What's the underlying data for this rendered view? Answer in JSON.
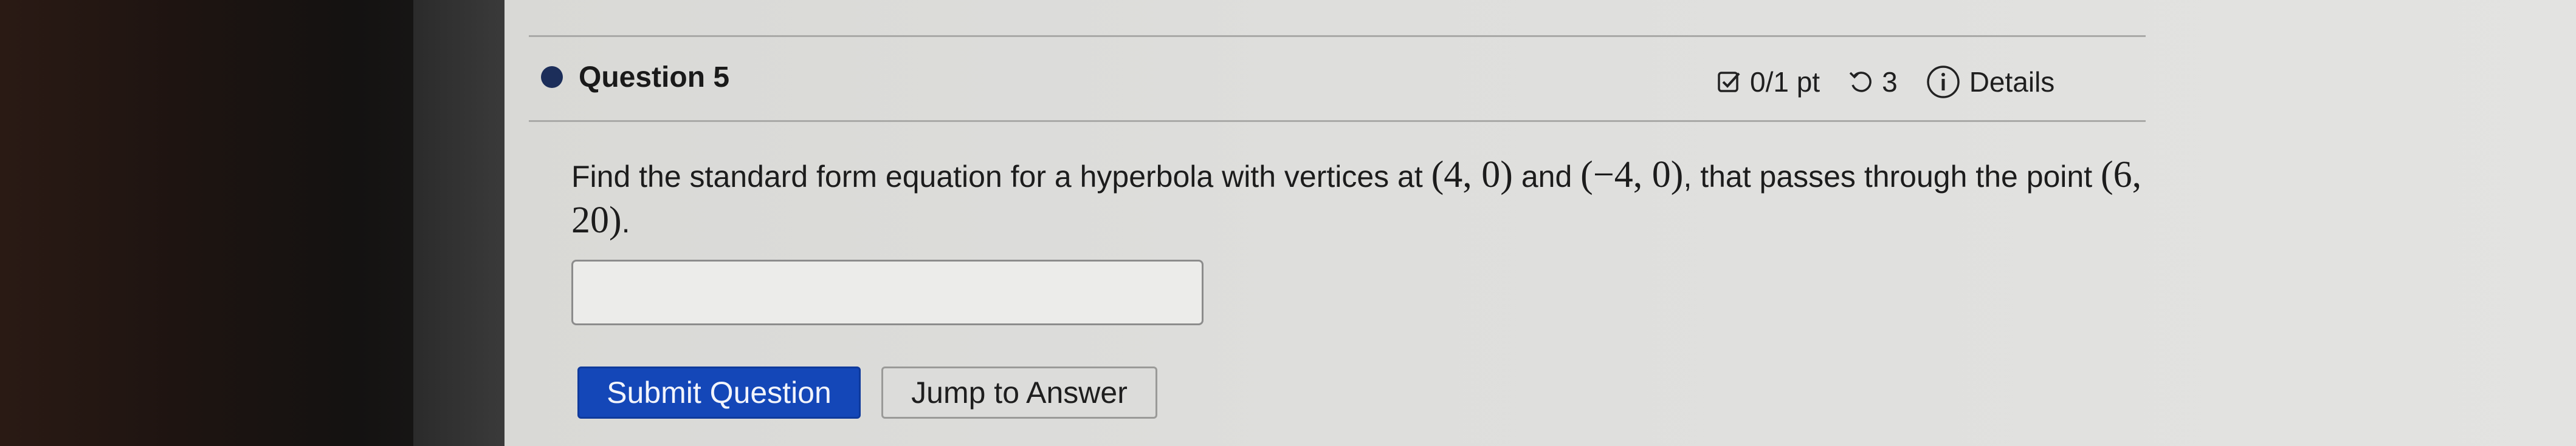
{
  "question": {
    "title": "Question 5",
    "score": "0/1 pt",
    "retries": "3",
    "details_label": "Details",
    "text_part1": "Find the standard form equation for a hyperbola with vertices at ",
    "math1": "(4, 0)",
    "text_and": " and ",
    "math2": "(−4, 0)",
    "text_part2": ", that passes through the point ",
    "math3": "(6, 20)",
    "text_end": ".",
    "answer_value": ""
  },
  "buttons": {
    "submit_label": "Submit Question",
    "jump_label": "Jump to Answer"
  },
  "colors": {
    "submit_bg": "#1447b8",
    "bullet": "#1c2e5a"
  },
  "icons": {
    "score": "checkbox-icon",
    "retries": "retry-icon",
    "details": "info-icon"
  }
}
